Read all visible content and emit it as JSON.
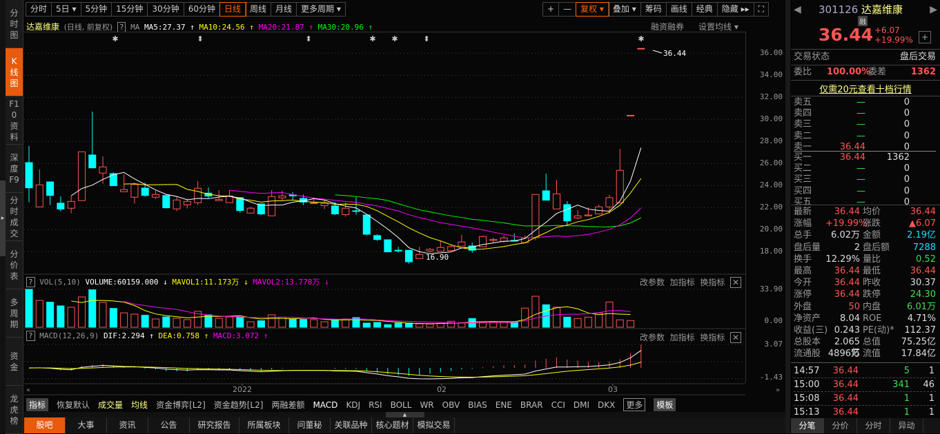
{
  "sidebar": {
    "tabs": [
      "分时图",
      "K线图",
      "F10资料",
      "深度F9",
      "分时成交",
      "分价表",
      "多周期",
      "资金",
      "龙虎榜"
    ],
    "active": 1
  },
  "toolbar": {
    "periods": [
      "分时",
      "5日 ▾",
      "5分钟",
      "15分钟",
      "30分钟",
      "60分钟",
      "日线",
      "周线",
      "月线",
      "更多周期 ▾"
    ],
    "active": 6,
    "tools": [
      "+",
      "—",
      "复权 ▾",
      "叠加 ▾",
      "筹码",
      "画线",
      "经典",
      "隐藏 ▸▸",
      "⛶"
    ],
    "active_tool": 2
  },
  "chart_header": {
    "name": "达嘉维康",
    "mode": "(日线, 前复权)",
    "help": "?",
    "ma": "MA",
    "ma5": "MA5:27.37 ↑",
    "ma10": "MA10:24.56 ↑",
    "ma20": "MA20:21.87 ↑",
    "ma30": "MA30:20.96 ↑",
    "margin": "融资融券",
    "set_ma": "设置均线 ▾"
  },
  "markers": [
    "✱",
    "⬍",
    "⬍",
    "✱",
    "✱",
    "⬍",
    "✱"
  ],
  "annotations": {
    "high": "36.44",
    "low": "16.90"
  },
  "price_axis": [
    "36.00",
    "34.00",
    "32.00",
    "30.00",
    "28.00",
    "26.00",
    "24.00",
    "22.00",
    "20.00",
    "18.00"
  ],
  "vol_header": {
    "help": "?",
    "name": "VOL(5,10)",
    "volume": "VOLUME:60159.000 ↓",
    "mavol1": "MAVOL1:11.173万 ↓",
    "mavol2": "MAVOL2:13.778万 ↓",
    "params": "改参数",
    "add": "加指标",
    "switch": "换指标",
    "close": "✕"
  },
  "vol_axis": [
    "33.90",
    "0.00"
  ],
  "macd_header": {
    "help": "?",
    "name": "MACD(12,26,9)",
    "dif": "DIF:2.294 ↑",
    "dea": "DEA:0.758 ↑",
    "macd": "MACD:3.072 ↑",
    "params": "改参数",
    "add": "加指标",
    "switch": "换指标",
    "close": "✕"
  },
  "macd_axis": [
    "3.07",
    "-1.43"
  ],
  "x_axis": [
    "2022",
    "02",
    "03"
  ],
  "indicator_tabs": [
    "指标",
    "恢复默认",
    "成交量",
    "均线",
    "资金博弈[L2]",
    "资金趋势[L2]",
    "两融差额",
    "MACD",
    "KDJ",
    "RSI",
    "BOLL",
    "WR",
    "OBV",
    "BIAS",
    "ENE",
    "BRAR",
    "CCI",
    "DMI",
    "DKX",
    "更多",
    "模板"
  ],
  "bottom_tabs": [
    "股吧",
    "大事",
    "资讯",
    "公告",
    "研究报告",
    "所属板块",
    "问董秘",
    "关联品种",
    "核心题材",
    "模拟交易"
  ],
  "colors": {
    "up": "#ff5555",
    "down": "#00ffff",
    "ma5": "#ffffff",
    "ma10": "#ffff00",
    "ma20": "#ff00ff",
    "ma30": "#00ff00",
    "accent": "#e85a0c"
  },
  "quote": {
    "code": "301126",
    "name": "达嘉维康",
    "badge": "融",
    "price": "36.44",
    "change": "+6.07",
    "pct": "+19.99%",
    "status_label": "交易状态",
    "status": "盘后交易",
    "wb_label": "委比",
    "wb": "100.00%",
    "wc_label": "委差",
    "wc": "1362",
    "promo": "仅需20元查看十档行情",
    "asks": [
      [
        "卖五",
        "—",
        "0"
      ],
      [
        "卖四",
        "—",
        "0"
      ],
      [
        "卖三",
        "—",
        "0"
      ],
      [
        "卖二",
        "—",
        "0"
      ],
      [
        "卖一",
        "36.44",
        "0"
      ]
    ],
    "bids": [
      [
        "买一",
        "36.44",
        "1362"
      ],
      [
        "买二",
        "—",
        "0"
      ],
      [
        "买三",
        "—",
        "0"
      ],
      [
        "买四",
        "—",
        "0"
      ],
      [
        "买五",
        "—",
        "0"
      ]
    ],
    "stats": [
      [
        "最新",
        "36.44",
        "均价",
        "36.44"
      ],
      [
        "涨幅",
        "+19.99%",
        "涨跌",
        "▲6.07"
      ],
      [
        "总手",
        "6.02万",
        "金额",
        "2.19亿"
      ],
      [
        "盘后量",
        "2",
        "盘后额",
        "7288"
      ],
      [
        "换手",
        "12.29%",
        "量比",
        "0.52"
      ],
      [
        "最高",
        "36.44",
        "最低",
        "36.44"
      ],
      [
        "今开",
        "36.44",
        "昨收",
        "30.37"
      ],
      [
        "涨停",
        "36.44",
        "跌停",
        "24.30"
      ],
      [
        "外盘",
        "50",
        "内盘",
        "6.01万"
      ],
      [
        "净资产",
        "8.04",
        "ROE",
        "4.71%"
      ],
      [
        "收益(三)",
        "0.243",
        "PE(动)*",
        "112.37"
      ],
      [
        "总股本",
        "2.065亿",
        "总值",
        "75.25亿"
      ],
      [
        "流通股",
        "4896万",
        "流值",
        "17.84亿"
      ]
    ],
    "stat_colors": [
      [
        "red",
        "red"
      ],
      [
        "red",
        "red"
      ],
      [
        "wht",
        "cyn"
      ],
      [
        "wht",
        "cyn"
      ],
      [
        "wht",
        "grn"
      ],
      [
        "red",
        "red"
      ],
      [
        "red",
        "wht"
      ],
      [
        "red",
        "grn"
      ],
      [
        "red",
        "grn"
      ],
      [
        "wht",
        "wht"
      ],
      [
        "wht",
        "wht"
      ],
      [
        "wht",
        "wht"
      ],
      [
        "wht",
        "wht"
      ]
    ],
    "ticks": [
      [
        "14:57",
        "36.44",
        "5",
        "1"
      ],
      [
        "15:00",
        "36.44",
        "341",
        "46"
      ],
      [
        "15:08",
        "36.44",
        "1",
        "1"
      ],
      [
        "15:13",
        "36.44",
        "1",
        "1"
      ]
    ],
    "tabs": [
      "分笔",
      "分价",
      "分时",
      "异动"
    ]
  },
  "chart_data": {
    "type": "candlestick",
    "ylim": [
      16,
      37
    ],
    "vol_ylim": [
      0,
      33.9
    ],
    "macd_ylim": [
      -1.43,
      3.07
    ],
    "ohlc": [
      [
        26.08,
        27.58,
        22.48,
        23.79
      ],
      [
        22.06,
        25.46,
        22.06,
        24.06
      ],
      [
        24.33,
        24.33,
        22.23,
        23.1
      ],
      [
        22.4,
        23.02,
        21.67,
        21.86
      ],
      [
        21.94,
        23.06,
        21.48,
        22.56
      ],
      [
        22.63,
        27.06,
        22.63,
        27.06
      ],
      [
        26.77,
        30.71,
        25.6,
        25.6
      ],
      [
        25.13,
        26.65,
        24.17,
        25.69
      ],
      [
        25.08,
        25.21,
        23.98,
        23.98
      ],
      [
        23.44,
        25.02,
        23.44,
        23.63
      ],
      [
        22.94,
        24.25,
        22.36,
        24.09
      ],
      [
        23.77,
        24.25,
        22.98,
        23.1
      ],
      [
        22.94,
        23.54,
        22.79,
        23.19
      ],
      [
        23.1,
        23.1,
        21.92,
        21.98
      ],
      [
        21.88,
        22.98,
        21.67,
        22.69
      ],
      [
        22.25,
        22.81,
        21.92,
        22.56
      ],
      [
        22.44,
        24.4,
        22.23,
        23.75
      ],
      [
        23.31,
        23.83,
        22.85,
        23.04
      ],
      [
        22.63,
        23.58,
        22.63,
        22.75
      ],
      [
        22.44,
        23.56,
        22.44,
        23.06
      ],
      [
        22.9,
        22.9,
        21.54,
        21.73
      ],
      [
        21.5,
        22.08,
        21.5,
        21.94
      ],
      [
        22.33,
        22.33,
        21.33,
        21.42
      ],
      [
        21.25,
        23.58,
        21.25,
        23.0
      ],
      [
        22.88,
        23.52,
        22.67,
        23.06
      ],
      [
        23.15,
        23.4,
        22.71,
        23.06
      ],
      [
        22.83,
        23.19,
        22.23,
        22.5
      ],
      [
        22.4,
        22.94,
        22.4,
        22.42
      ],
      [
        22.17,
        22.67,
        21.86,
        22.38
      ],
      [
        22.15,
        22.5,
        21.33,
        21.42
      ],
      [
        21.36,
        22.46,
        21.17,
        21.94
      ],
      [
        21.71,
        22.98,
        21.36,
        21.65
      ],
      [
        21.33,
        21.33,
        19.48,
        19.58
      ],
      [
        19.46,
        19.58,
        18.98,
        19.1
      ],
      [
        19.08,
        19.08,
        17.98,
        17.98
      ],
      [
        18.13,
        18.44,
        17.92,
        18.06
      ],
      [
        18.13,
        18.13,
        16.9,
        17.08
      ],
      [
        17.38,
        18.44,
        17.38,
        17.75
      ],
      [
        18.06,
        18.33,
        17.92,
        18.21
      ],
      [
        18.04,
        18.96,
        18.04,
        18.38
      ],
      [
        18.1,
        18.65,
        18.1,
        18.46
      ],
      [
        18.5,
        19.52,
        18.5,
        18.88
      ],
      [
        18.52,
        18.83,
        17.92,
        18.13
      ],
      [
        18.44,
        19.44,
        18.44,
        19.38
      ],
      [
        19.02,
        19.27,
        18.79,
        19.1
      ],
      [
        18.94,
        19.46,
        18.79,
        19.25
      ],
      [
        19.02,
        19.65,
        18.96,
        18.96
      ],
      [
        18.81,
        19.48,
        18.81,
        19.27
      ],
      [
        19.27,
        23.19,
        19.04,
        23.19
      ],
      [
        23.52,
        25.08,
        22.67,
        22.67
      ],
      [
        21.88,
        24.52,
        21.88,
        23.25
      ],
      [
        22.27,
        22.58,
        20.42,
        20.79
      ],
      [
        21.06,
        21.77,
        20.94,
        21.25
      ],
      [
        21.25,
        22.02,
        21.25,
        21.33
      ],
      [
        21.42,
        22.27,
        21.42,
        22.06
      ],
      [
        22.06,
        23.15,
        21.46,
        22.9
      ],
      [
        22.42,
        27.33,
        22.42,
        25.38
      ],
      [
        30.37,
        30.37,
        30.37,
        30.37
      ],
      [
        36.44,
        36.44,
        36.44,
        36.44
      ]
    ],
    "volume": [
      33.9,
      24.0,
      22.4,
      19.1,
      17.9,
      27.1,
      33.5,
      22.2,
      16.8,
      12.9,
      11.7,
      10.7,
      7.4,
      9.2,
      8.0,
      6.8,
      14.2,
      11.1,
      8.0,
      9.2,
      9.0,
      4.9,
      5.8,
      11.1,
      9.0,
      7.4,
      7.0,
      6.8,
      4.9,
      6.6,
      7.4,
      8.6,
      3.7,
      4.3,
      2.3,
      3.7,
      3.7,
      3.1,
      2.9,
      3.5,
      5.3,
      4.1,
      7.8,
      4.1,
      4.3,
      4.3,
      4.3,
      17.1,
      27.7,
      20.1,
      17.9,
      9.0,
      7.8,
      9.0,
      12.7,
      22.6,
      6.6,
      6.0
    ]
  }
}
